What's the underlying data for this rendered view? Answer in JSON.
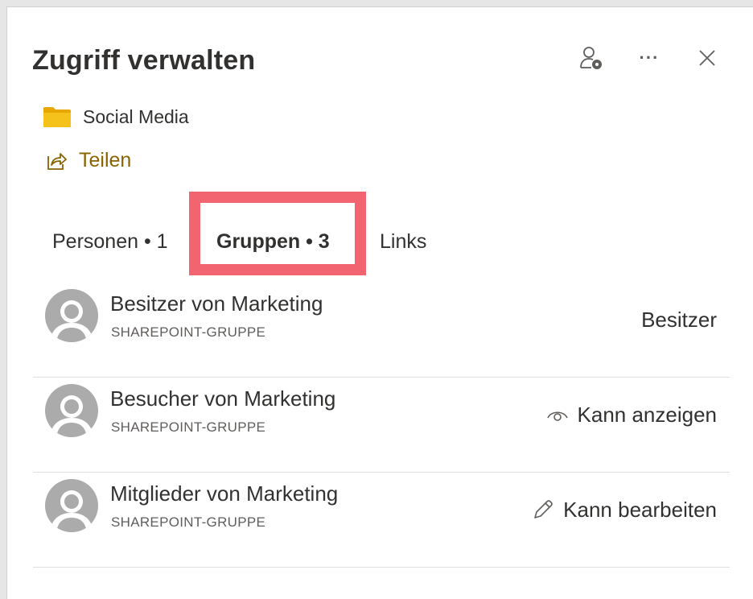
{
  "panel": {
    "title": "Zugriff verwalten",
    "actions": [
      {
        "icon": "person-settings-icon"
      },
      {
        "icon": "more-icon",
        "label": "···"
      },
      {
        "icon": "close-icon"
      }
    ]
  },
  "item": {
    "icon": "folder-icon",
    "name": "Social Media",
    "folder_color": "#f5c21b"
  },
  "share": {
    "icon": "share-icon",
    "label": "Teilen",
    "color": "#8a6300"
  },
  "tabs": [
    {
      "label": "Personen • 1",
      "active": false
    },
    {
      "label": "Gruppen • 3",
      "active": true
    },
    {
      "label": "Links",
      "active": false
    }
  ],
  "highlight_color": "#f16470",
  "groups": [
    {
      "name": "Besitzer von Marketing",
      "type": "SHAREPOINT-GRUPPE",
      "permission": "Besitzer",
      "permission_icon": ""
    },
    {
      "name": "Besucher von Marketing",
      "type": "SHAREPOINT-GRUPPE",
      "permission": "Kann anzeigen",
      "permission_icon": "eye-icon"
    },
    {
      "name": "Mitglieder von Marketing",
      "type": "SHAREPOINT-GRUPPE",
      "permission": "Kann bearbeiten",
      "permission_icon": "pencil-icon"
    }
  ]
}
